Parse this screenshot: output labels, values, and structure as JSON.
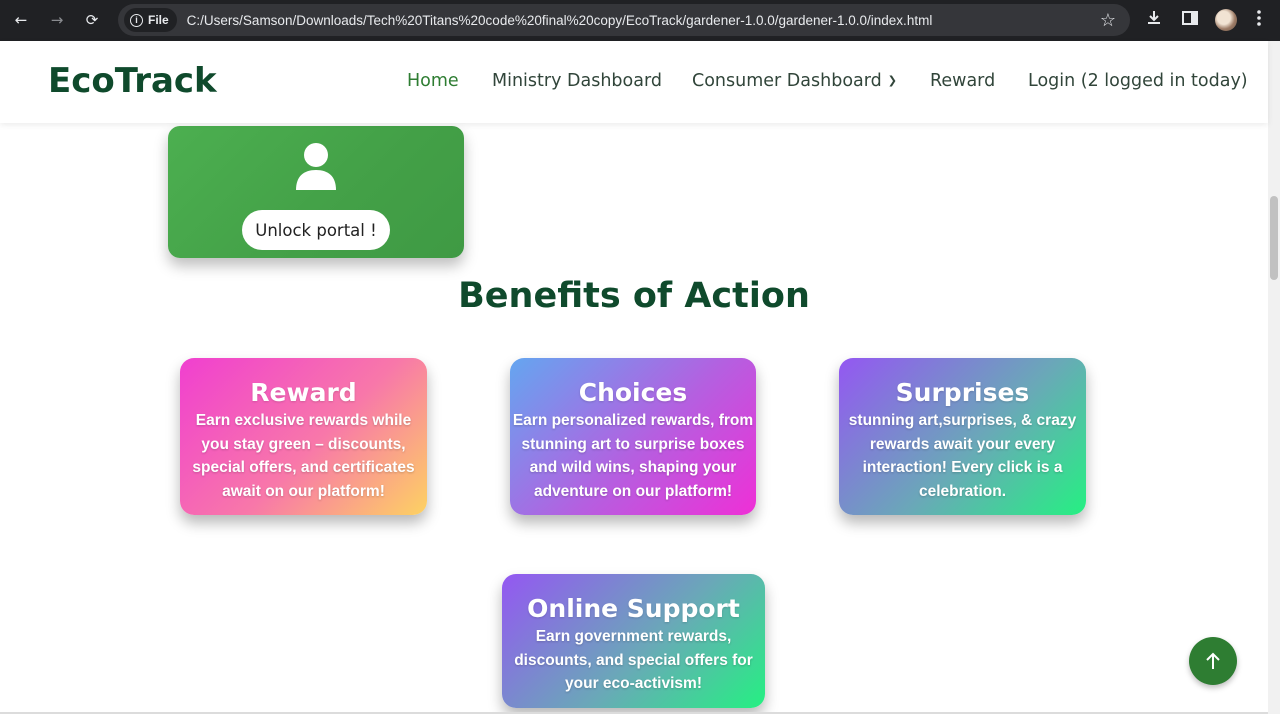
{
  "browser": {
    "back_icon": "back-arrow-icon",
    "forward_icon": "forward-arrow-icon",
    "reload_icon": "reload-icon",
    "file_label": "File",
    "url": "C:/Users/Samson/Downloads/Tech%20Titans%20code%20final%20copy/EcoTrack/gardener-1.0.0/gardener-1.0.0/index.html"
  },
  "header": {
    "logo": "EcoTrack",
    "nav": {
      "home": "Home",
      "ministry": "Ministry Dashboard",
      "consumer": "Consumer Dashboard",
      "reward": "Reward",
      "login": "Login (2 logged in today)"
    }
  },
  "unlock": {
    "button_label": "Unlock portal !"
  },
  "section": {
    "title": "Benefits of Action"
  },
  "cards": [
    {
      "title": "Reward",
      "text": "Earn exclusive rewards while you stay green – discounts, special offers, and certificates await on our platform!"
    },
    {
      "title": "Choices",
      "text": "Earn personalized rewards, from stunning art to surprise boxes and wild wins, shaping your adventure on our platform!"
    },
    {
      "title": "Surprises",
      "text": "stunning art,surprises, & crazy rewards await your every interaction! Every click is a celebration."
    },
    {
      "title": "Online Support",
      "text": "Earn government rewards, discounts, and special offers for your eco-activism!"
    }
  ],
  "colors": {
    "brand_dark_green": "#0f4a2c",
    "active_green": "#2e7d32",
    "chrome_dark": "#202124"
  }
}
